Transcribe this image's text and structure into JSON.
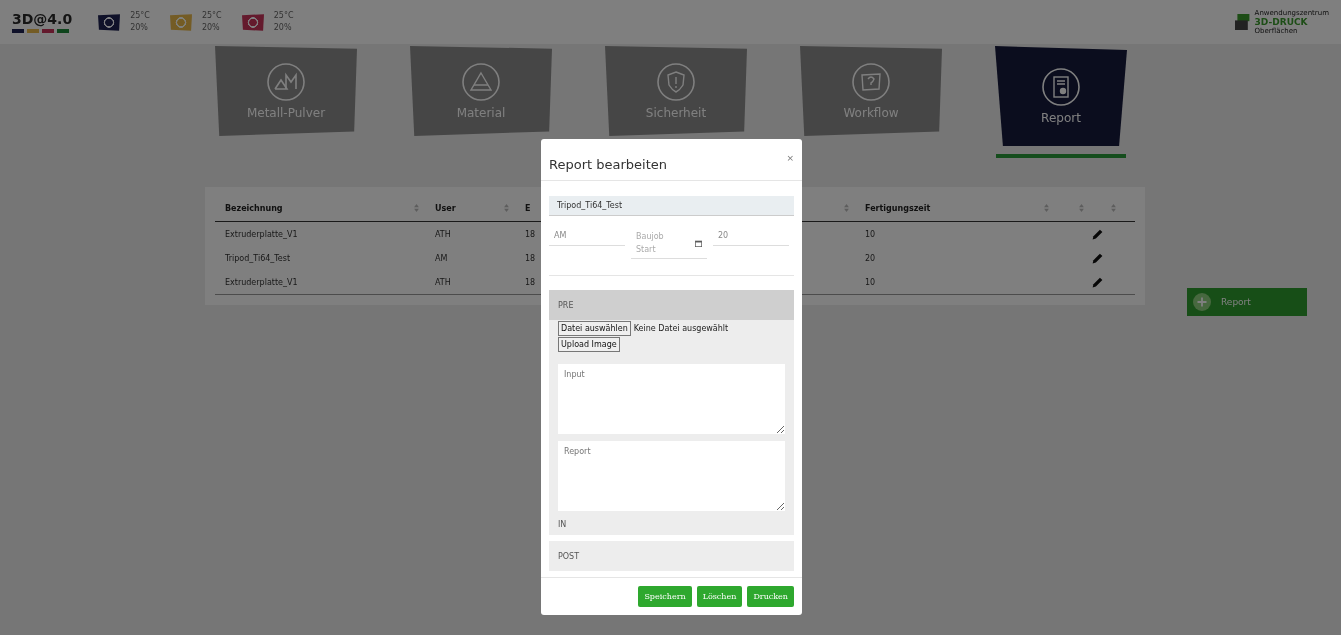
{
  "header": {
    "logo": "3D@4.0",
    "logo_stripes": [
      {
        "color": "#0f1129"
      },
      {
        "color": "#745c25"
      },
      {
        "color": "#641a2d"
      },
      {
        "color": "#0f451d"
      }
    ],
    "printers": [
      {
        "color": "#0f1129",
        "temperature": "25°C",
        "humidity": "20%"
      },
      {
        "color": "#745c25",
        "temperature": "25°C",
        "humidity": "20%"
      },
      {
        "color": "#641a2d",
        "temperature": "25°C",
        "humidity": "20%"
      }
    ],
    "partner_logo": [
      "Anwendungszentrum",
      "3D-DRUCK",
      "Oberflächen"
    ]
  },
  "tabs": [
    {
      "label": "Metall-Pulver",
      "kind": "metal",
      "selected": false
    },
    {
      "label": "Material",
      "kind": "material",
      "selected": false
    },
    {
      "label": "Sicherheit",
      "kind": "safety",
      "selected": false
    },
    {
      "label": "Workflow",
      "kind": "workflow",
      "selected": false
    },
    {
      "label": "Report",
      "kind": "report",
      "selected": true
    }
  ],
  "table": {
    "columns": [
      "Bezeichnung",
      "User",
      "E",
      "Fertigungszeit"
    ],
    "rows": [
      {
        "cells": [
          "Extruderplatte_V1",
          "ATH",
          "18",
          "10"
        ]
      },
      {
        "cells": [
          "Tripod_Ti64_Test",
          "AM",
          "18",
          "20"
        ]
      },
      {
        "cells": [
          "Extruderplatte_V1",
          "ATH",
          "18",
          "10"
        ]
      }
    ]
  },
  "add_button": "Report",
  "modal": {
    "title": "Report bearbeiten",
    "close": "×",
    "name": "Tripod_Ti64_Test",
    "fields": [
      {
        "kind": "text",
        "value": "AM"
      },
      {
        "kind": "date",
        "placeholder": "Baujob Start"
      },
      {
        "kind": "text",
        "value": "20"
      }
    ],
    "pre": {
      "title": "PRE",
      "file_button": "Datei auswählen",
      "file_status": "Keine Datei ausgewählt",
      "upload_button": "Upload Image",
      "textareas": [
        {
          "placeholder": "Input"
        },
        {
          "placeholder": "Report"
        }
      ],
      "footer": "IN"
    },
    "post": "POST",
    "buttons": [
      "Speichern",
      "Löschen",
      "Drucken"
    ]
  }
}
